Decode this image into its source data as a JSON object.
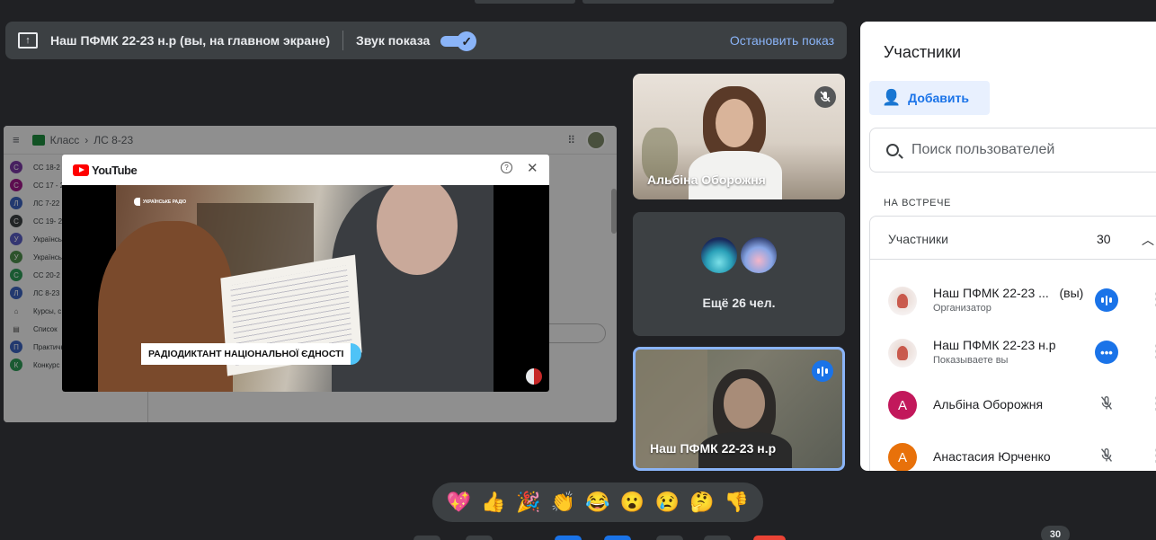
{
  "banner": {
    "title": "Наш ПФМК 22-23 н.р (вы, на главном экране)",
    "sound_label": "Звук показа",
    "sound_on": true,
    "stop_label": "Остановить показ",
    "present_icon": "present-to-all-icon"
  },
  "shared_screen": {
    "breadcrumb_class": "Класс",
    "breadcrumb_sep": "›",
    "breadcrumb_item": "ЛС 8-23",
    "classes": [
      {
        "letter": "C",
        "name": "СС 18-2",
        "color": "#7b3aa6"
      },
      {
        "letter": "C",
        "name": "СС 17 - 2",
        "color": "#a0188a"
      },
      {
        "letter": "Л",
        "name": "ЛС 7-22",
        "color": "#3b63c0"
      },
      {
        "letter": "C",
        "name": "СС 19- 2",
        "color": "#3c4043"
      },
      {
        "letter": "У",
        "name": "Українсь",
        "color": "#5a5dc4"
      },
      {
        "letter": "У",
        "name": "Українсь",
        "color": "#4e8f4c"
      },
      {
        "letter": "C",
        "name": "СС 20-2",
        "color": "#2e9b57"
      },
      {
        "letter": "Л",
        "name": "ЛС 8-23",
        "color": "#3b63c0"
      }
    ],
    "extra_items": [
      "Курсы, с",
      "Список",
      "Практичне заняття",
      "Конкурс ім. П.Яцика"
    ],
    "youtube": {
      "brand": "YouTube",
      "channel": "УКРАЇНСЬКЕ РАДІО",
      "caption": "РАДІОДИКТАНТ НАЦІОНАЛЬНОЇ ЄДНОСТІ"
    }
  },
  "tiles": [
    {
      "name": "Альбіна Оборожня",
      "muted": true
    },
    {
      "more_label": "Ещё 26 чел."
    },
    {
      "name": "Наш ПФМК 22-23 н.р",
      "speaking": true
    }
  ],
  "panel": {
    "title": "Участники",
    "add_label": "Добавить",
    "search_placeholder": "Поиск пользователей",
    "section_label": "НА ВСТРЕЧЕ",
    "group_label": "Участники",
    "group_count": "30",
    "participants": [
      {
        "name": "Наш ПФМК 22-23 ...",
        "suffix": "(вы)",
        "role": "Организатор",
        "status": "speaking"
      },
      {
        "name": "Наш ПФМК 22-23 н.р",
        "role": "Показываете вы",
        "status": "more"
      },
      {
        "name": "Альбіна Оборожня",
        "avatar_letter": "A",
        "avatar_color": "#c2185b",
        "status": "muted"
      },
      {
        "name": "Анастасия Юрченко",
        "avatar_letter": "A",
        "avatar_color": "#e8710a",
        "status": "muted"
      }
    ]
  },
  "reactions": [
    "💖",
    "👍",
    "🎉",
    "👏",
    "😂",
    "😮",
    "😢",
    "🤔",
    "👎"
  ],
  "people_count": "30"
}
